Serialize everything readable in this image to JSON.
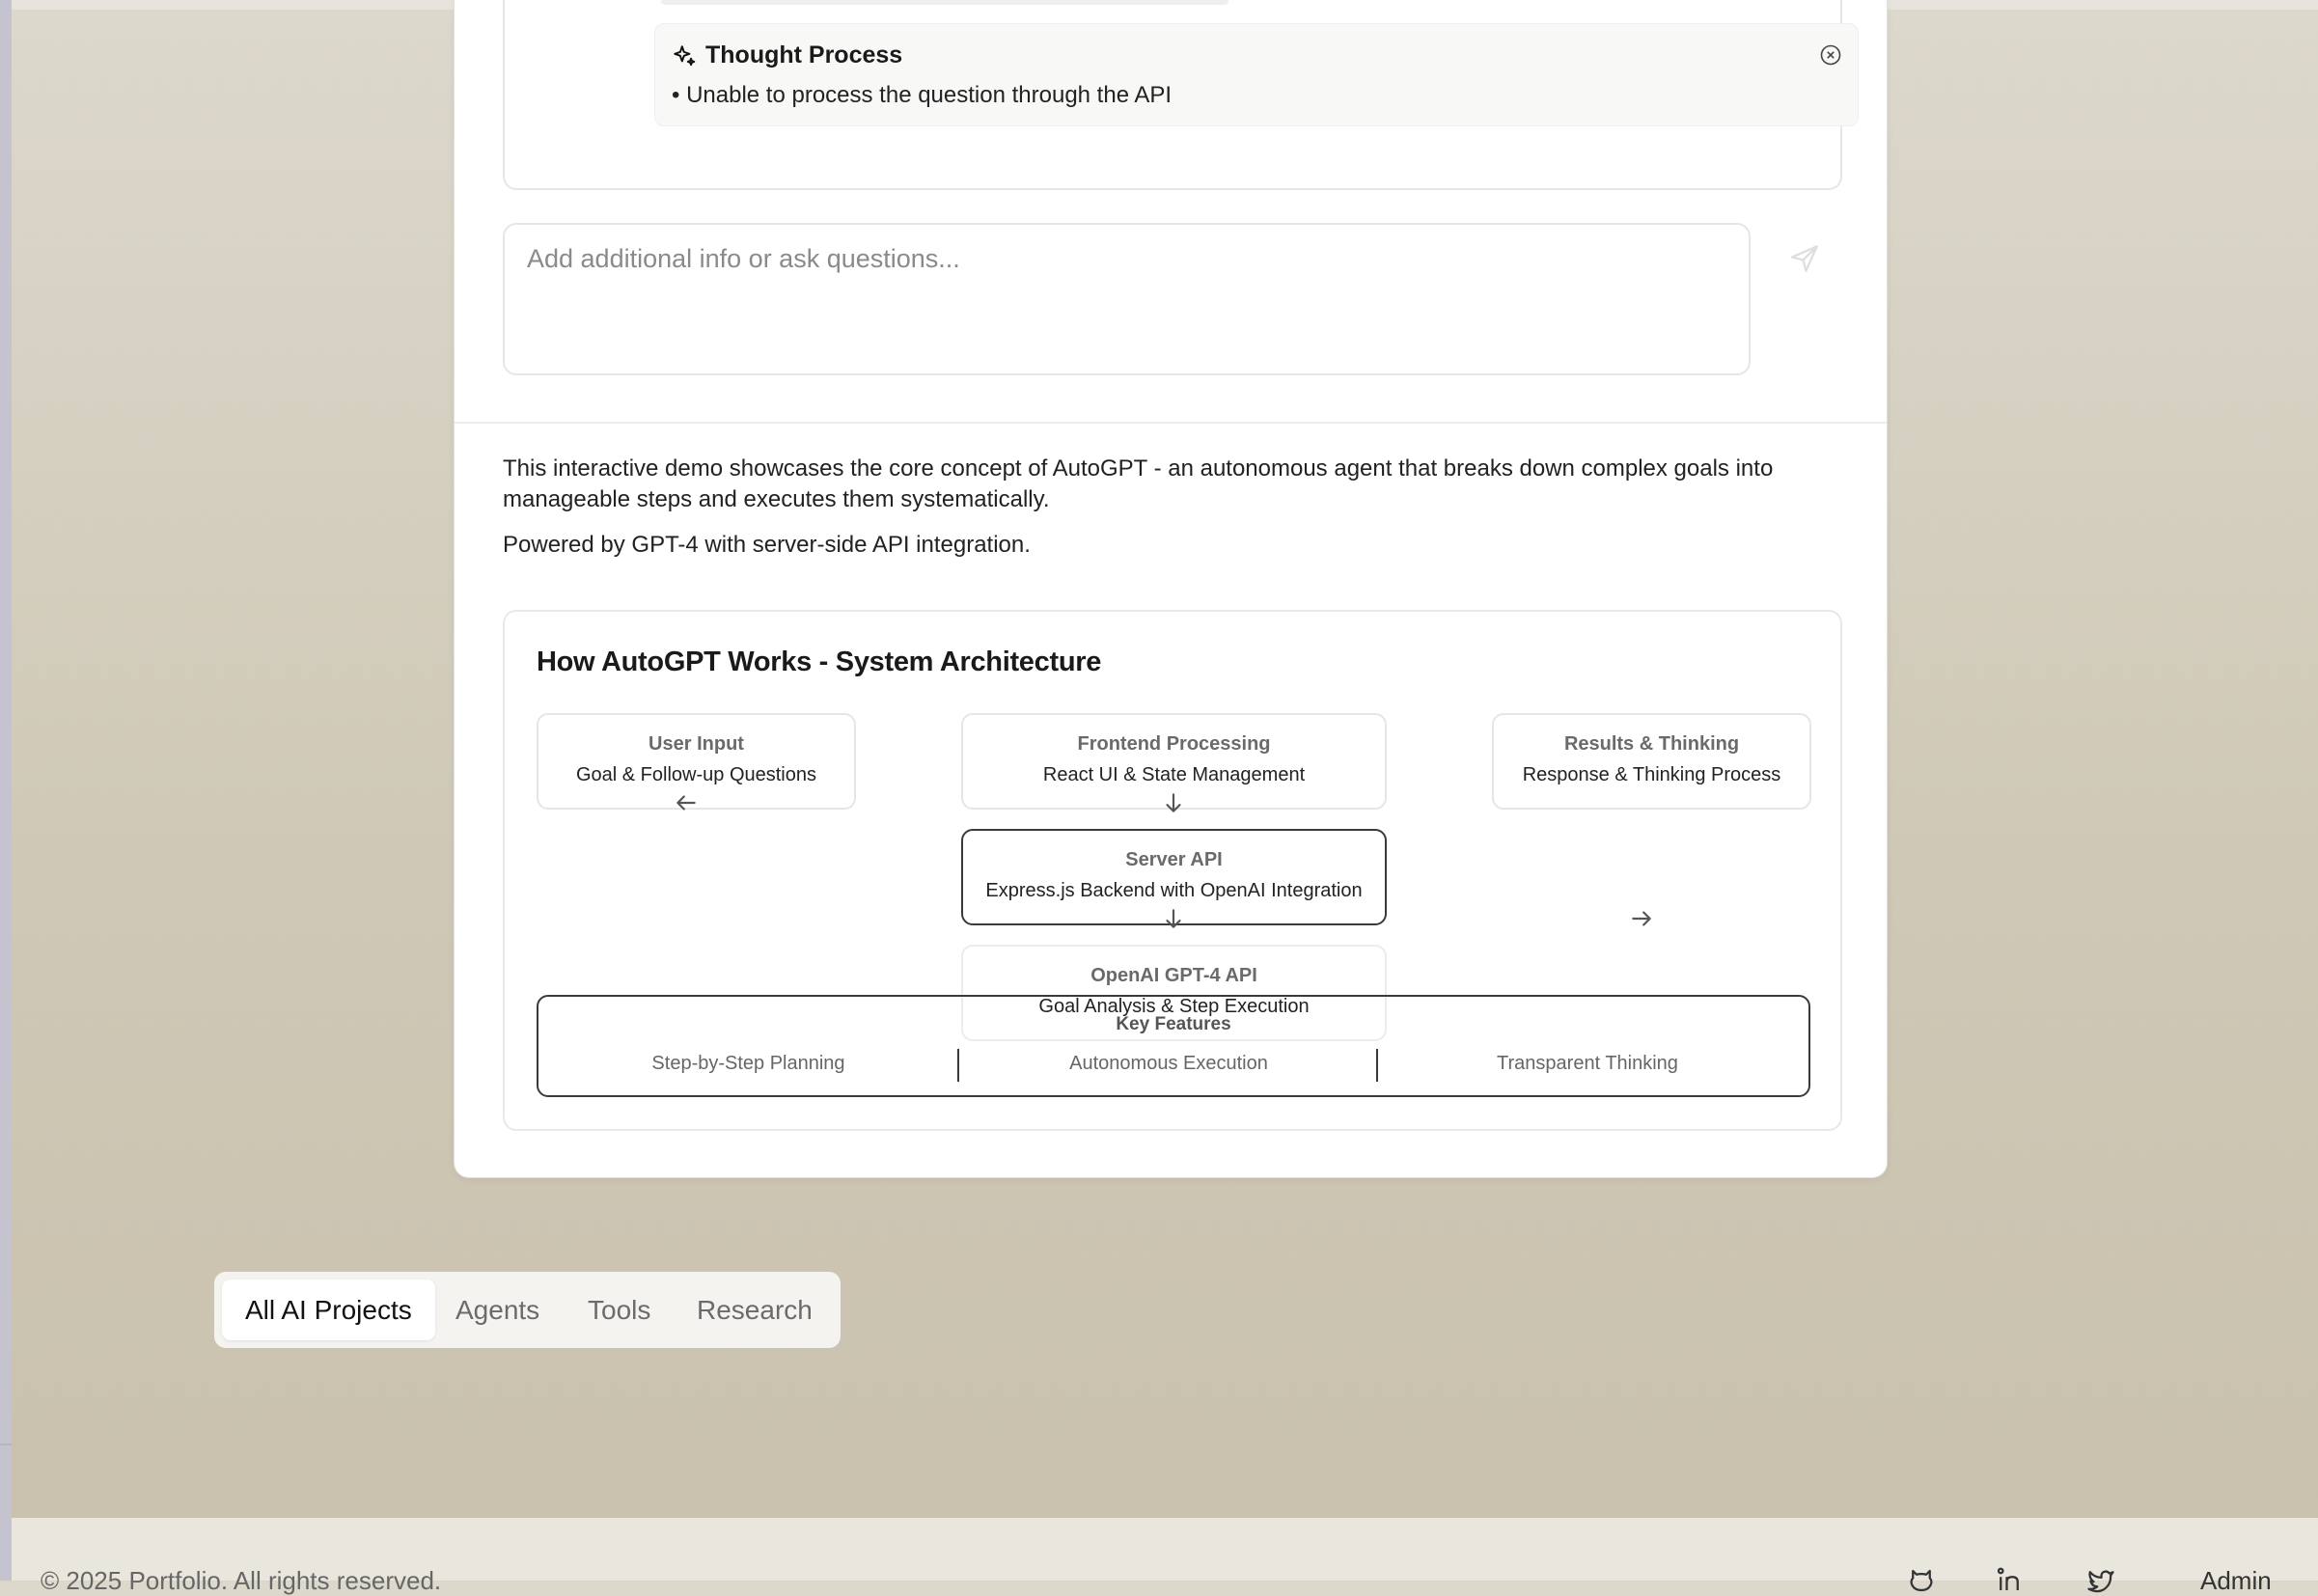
{
  "thought_process": {
    "title": "Thought Process",
    "items": [
      "• Unable to process the question through the API"
    ],
    "icons": {
      "title": "sparkles-icon",
      "close": "close-circle-icon"
    }
  },
  "chat_input": {
    "placeholder": "Add additional info or ask questions...",
    "send_icon": "send-icon"
  },
  "description": {
    "text": "This interactive demo showcases the core concept of AutoGPT - an autonomous agent that breaks down complex goals into manageable steps and executes them systematically.",
    "powered_by": "Powered by GPT-4 with server-side API integration."
  },
  "architecture": {
    "title": "How AutoGPT Works - System Architecture",
    "nodes": {
      "user_input": {
        "title": "User Input",
        "subtitle": "Goal & Follow-up Questions"
      },
      "frontend": {
        "title": "Frontend Processing",
        "subtitle": "React UI & State Management"
      },
      "results": {
        "title": "Results & Thinking",
        "subtitle": "Response & Thinking Process"
      },
      "server_api": {
        "title": "Server API",
        "subtitle": "Express.js Backend with OpenAI Integration"
      },
      "openai": {
        "title": "OpenAI GPT-4 API",
        "subtitle": "Goal Analysis & Step Execution"
      }
    },
    "arrows": [
      "arrow-left-icon",
      "arrow-down-icon",
      "arrow-down-icon",
      "arrow-right-icon"
    ],
    "key_features": {
      "title": "Key Features",
      "items": [
        "Step-by-Step Planning",
        "Autonomous Execution",
        "Transparent Thinking"
      ]
    }
  },
  "filter_tabs": {
    "items": [
      "All AI Projects",
      "Agents",
      "Tools",
      "Research"
    ],
    "active": "All AI Projects"
  },
  "footer": {
    "copyright": "© 2025 Portfolio. All rights reserved.",
    "social_icons": [
      "github-icon",
      "linkedin-icon",
      "twitter-icon"
    ],
    "admin_label": "Admin"
  },
  "colors": {
    "background": "#d4cebf",
    "card": "#ffffff",
    "footer": "#e8e6dd",
    "dark_border": "#3a3a3a"
  }
}
